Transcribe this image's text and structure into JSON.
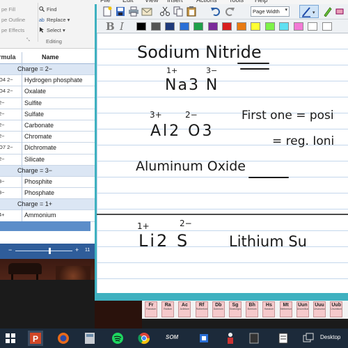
{
  "ribbon": {
    "shape_fill": "pe Fill",
    "shape_outline": "pe Outline",
    "shape_effects": "pe Effects",
    "find": "Find",
    "replace": "Replace",
    "select": "Select",
    "editing_group": "Editing"
  },
  "table": {
    "col_formula": "rmula",
    "col_name": "Name",
    "rows": [
      {
        "kind": "group",
        "formula": "",
        "name": "Charge = 2−"
      },
      {
        "kind": "row",
        "formula": "O4 2−",
        "name": "Hydrogen phosphate"
      },
      {
        "kind": "row",
        "formula": "O4 2−",
        "name": "Oxalate"
      },
      {
        "kind": "row",
        "formula": "2−",
        "name": "Sulfite"
      },
      {
        "kind": "row",
        "formula": "2−",
        "name": "Sulfate"
      },
      {
        "kind": "row",
        "formula": "2−",
        "name": "Carbonate"
      },
      {
        "kind": "row",
        "formula": "2−",
        "name": "Chromate"
      },
      {
        "kind": "row",
        "formula": "O7 2−",
        "name": "Dichromate"
      },
      {
        "kind": "row",
        "formula": "2−",
        "name": "Silicate"
      },
      {
        "kind": "group",
        "formula": "",
        "name": "Charge = 3−"
      },
      {
        "kind": "row",
        "formula": "3−",
        "name": "Phosphite"
      },
      {
        "kind": "row",
        "formula": "3−",
        "name": "Phosphate"
      },
      {
        "kind": "group",
        "formula": "",
        "name": "Charge = 1+"
      },
      {
        "kind": "row",
        "formula": "4+",
        "name": "Ammonium"
      }
    ]
  },
  "statusbar": {
    "zoom_minus": "−",
    "zoom_plus": "+",
    "zoom_value": "11"
  },
  "onenote": {
    "menu": [
      "File",
      "Edit",
      "View",
      "Insert",
      "Actions",
      "Tools",
      "Help"
    ],
    "zoom_select": "Page Width",
    "colors": [
      "#000000",
      "#555555",
      "#1f3a7a",
      "#2a6fd6",
      "#1fa04a",
      "#7a2a9a",
      "#d81e1e",
      "#e87a12",
      "#ffff33",
      "#7ef24a",
      "#5fe0f2",
      "#f27ad6",
      "#ffffff",
      "#ffffff"
    ]
  },
  "notes": {
    "line1": "Sodium Nitride",
    "na_charge": "1+",
    "n_charge": "3−",
    "formula1": "Na3 N",
    "al_charge": "3+",
    "o_charge": "2−",
    "formula2": "Al2 O3",
    "first_one": "First one = posi",
    "reg_ionic": "= reg. Ioni",
    "line3": "Aluminum Oxide",
    "li_charge": "1+",
    "s_charge": "2−",
    "formula3": "Li2 S",
    "line4": "Lithium Su"
  },
  "periodic": [
    {
      "sym": "Fr",
      "name": "Francium"
    },
    {
      "sym": "Ra",
      "name": "Radium"
    },
    {
      "sym": "Ac",
      "name": "Actinium"
    },
    {
      "sym": "Rf",
      "name": "Rutherfordium"
    },
    {
      "sym": "Db",
      "name": "Dubnium"
    },
    {
      "sym": "Sg",
      "name": "Seaborgium"
    },
    {
      "sym": "Bh",
      "name": "Bohrium"
    },
    {
      "sym": "Hs",
      "name": "Hassium"
    },
    {
      "sym": "Mt",
      "name": "Meitnerium"
    },
    {
      "sym": "Uun",
      "name": "Ununnilium"
    },
    {
      "sym": "Uuu",
      "name": "Unununium"
    },
    {
      "sym": "Uub",
      "name": "Ununbium"
    }
  ],
  "taskbar": {
    "som_label": "SOM",
    "desktop_label": "Desktop"
  }
}
